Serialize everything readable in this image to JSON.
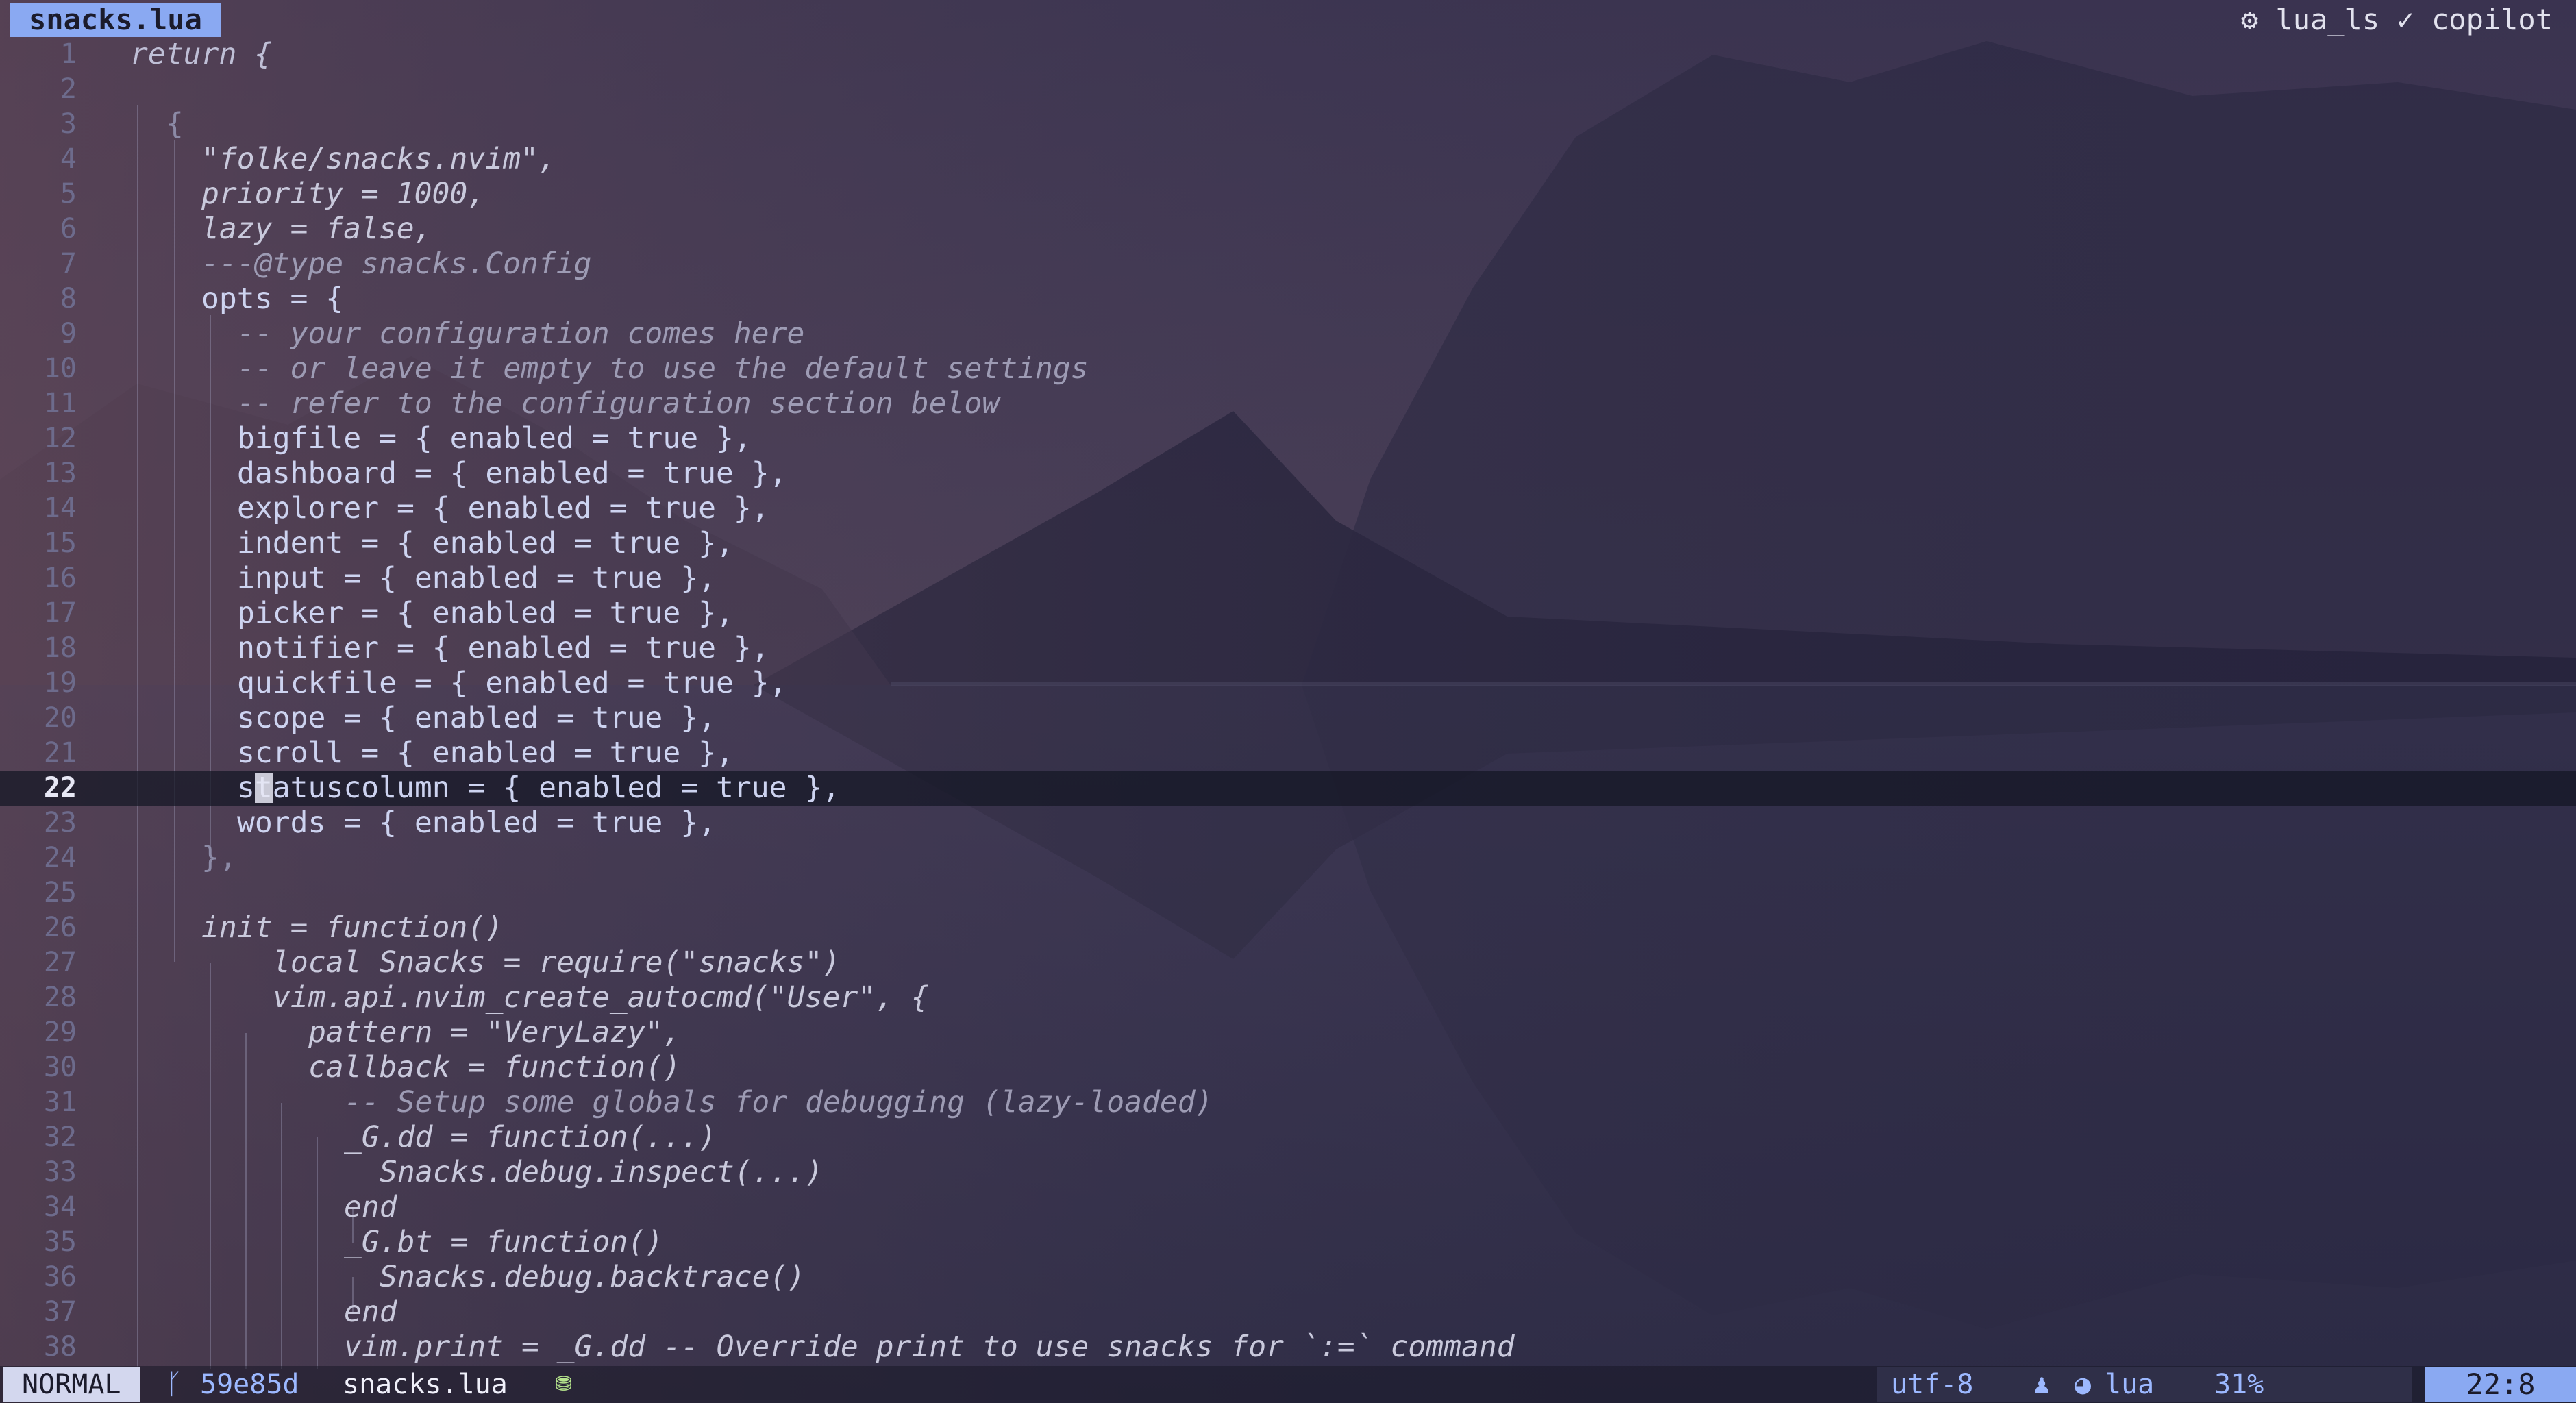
{
  "tab": {
    "filename": "snacks.lua"
  },
  "lsp_status": "⚙ lua_ls ✓ copilot",
  "lines": [
    {
      "n": "1",
      "t": "return {"
    },
    {
      "n": "2",
      "t": ""
    },
    {
      "n": "3",
      "t": "{"
    },
    {
      "n": "4",
      "t": "\"folke/snacks.nvim\","
    },
    {
      "n": "5",
      "t": "priority = 1000,"
    },
    {
      "n": "6",
      "t": "lazy = false,"
    },
    {
      "n": "7",
      "t": "---@type snacks.Config"
    },
    {
      "n": "8",
      "t": "opts = {"
    },
    {
      "n": "9",
      "t": "-- your configuration comes here"
    },
    {
      "n": "10",
      "t": "-- or leave it empty to use the default settings"
    },
    {
      "n": "11",
      "t": "-- refer to the configuration section below"
    },
    {
      "n": "12",
      "t": "bigfile = { enabled = true },"
    },
    {
      "n": "13",
      "t": "dashboard = { enabled = true },"
    },
    {
      "n": "14",
      "t": "explorer = { enabled = true },"
    },
    {
      "n": "15",
      "t": "indent = { enabled = true },"
    },
    {
      "n": "16",
      "t": "input = { enabled = true },"
    },
    {
      "n": "17",
      "t": "picker = { enabled = true },"
    },
    {
      "n": "18",
      "t": "notifier = { enabled = true },"
    },
    {
      "n": "19",
      "t": "quickfile = { enabled = true },"
    },
    {
      "n": "20",
      "t": "scope = { enabled = true },"
    },
    {
      "n": "21",
      "t": "scroll = { enabled = true },"
    },
    {
      "n": "22",
      "t": "statuscolumn = { enabled = true },"
    },
    {
      "n": "23",
      "t": "words = { enabled = true },"
    },
    {
      "n": "24",
      "t": "},"
    },
    {
      "n": "25",
      "t": ""
    },
    {
      "n": "26",
      "t": "init = function()"
    },
    {
      "n": "27",
      "t": "local Snacks = require(\"snacks\")"
    },
    {
      "n": "28",
      "t": "vim.api.nvim_create_autocmd(\"User\", {"
    },
    {
      "n": "29",
      "t": "pattern = \"VeryLazy\","
    },
    {
      "n": "30",
      "t": "callback = function()"
    },
    {
      "n": "31",
      "t": "-- Setup some globals for debugging (lazy-loaded)"
    },
    {
      "n": "32",
      "t": "_G.dd = function(...)"
    },
    {
      "n": "33",
      "t": "Snacks.debug.inspect(...)"
    },
    {
      "n": "34",
      "t": "end"
    },
    {
      "n": "35",
      "t": "_G.bt = function()"
    },
    {
      "n": "36",
      "t": "Snacks.debug.backtrace()"
    },
    {
      "n": "37",
      "t": "end"
    },
    {
      "n": "38",
      "t": "vim.print = _G.dd -- Override print to use snacks for `:=` command"
    }
  ],
  "statusbar": {
    "mode": "NORMAL",
    "git_icon": "ᚴ",
    "git_commit": "59e85d",
    "filename": "snacks.lua",
    "modified_icon": "⛃",
    "encoding": "utf-8",
    "os_icon": "♟",
    "filetype_icon": "◕",
    "filetype": "lua",
    "percent": "31%",
    "position": "22:8"
  }
}
